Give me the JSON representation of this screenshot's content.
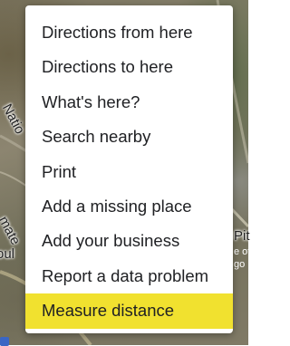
{
  "map": {
    "labels": {
      "nation": "Natio",
      "mate": "mate",
      "pul": "oul",
      "pi": "Pit",
      "eo": "e of",
      "go": "go"
    }
  },
  "context_menu": {
    "items": [
      {
        "label": "Directions from here"
      },
      {
        "label": "Directions to here"
      },
      {
        "label": "What's here?"
      },
      {
        "label": "Search nearby"
      },
      {
        "label": "Print"
      },
      {
        "label": "Add a missing place"
      },
      {
        "label": "Add your business"
      },
      {
        "label": "Report a data problem"
      },
      {
        "label": "Measure distance",
        "highlighted": true
      }
    ],
    "highlight_color": "#f1e12f"
  }
}
